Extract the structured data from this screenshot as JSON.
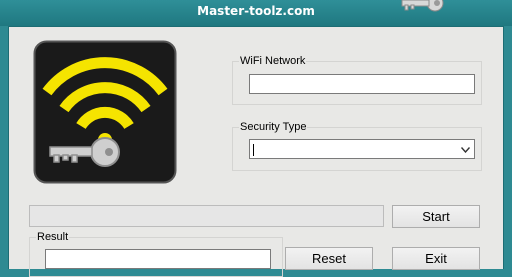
{
  "window": {
    "title": "Master-toolz.com"
  },
  "app": {
    "logo": {
      "icon": "wifi-key-logo"
    },
    "wifi_network": {
      "label": "WiFi Network",
      "value": ""
    },
    "security_type": {
      "label": "Security Type",
      "selected": ""
    },
    "progress": {
      "percent": 0
    },
    "result": {
      "label": "Result",
      "value": ""
    },
    "buttons": {
      "start": "Start",
      "reset": "Reset",
      "exit": "Exit"
    }
  },
  "colors": {
    "titlebar": "#2e8a92",
    "logo_waves": "#f5e400",
    "logo_bg": "#1a1a1a",
    "window": "#e8e8e6"
  }
}
